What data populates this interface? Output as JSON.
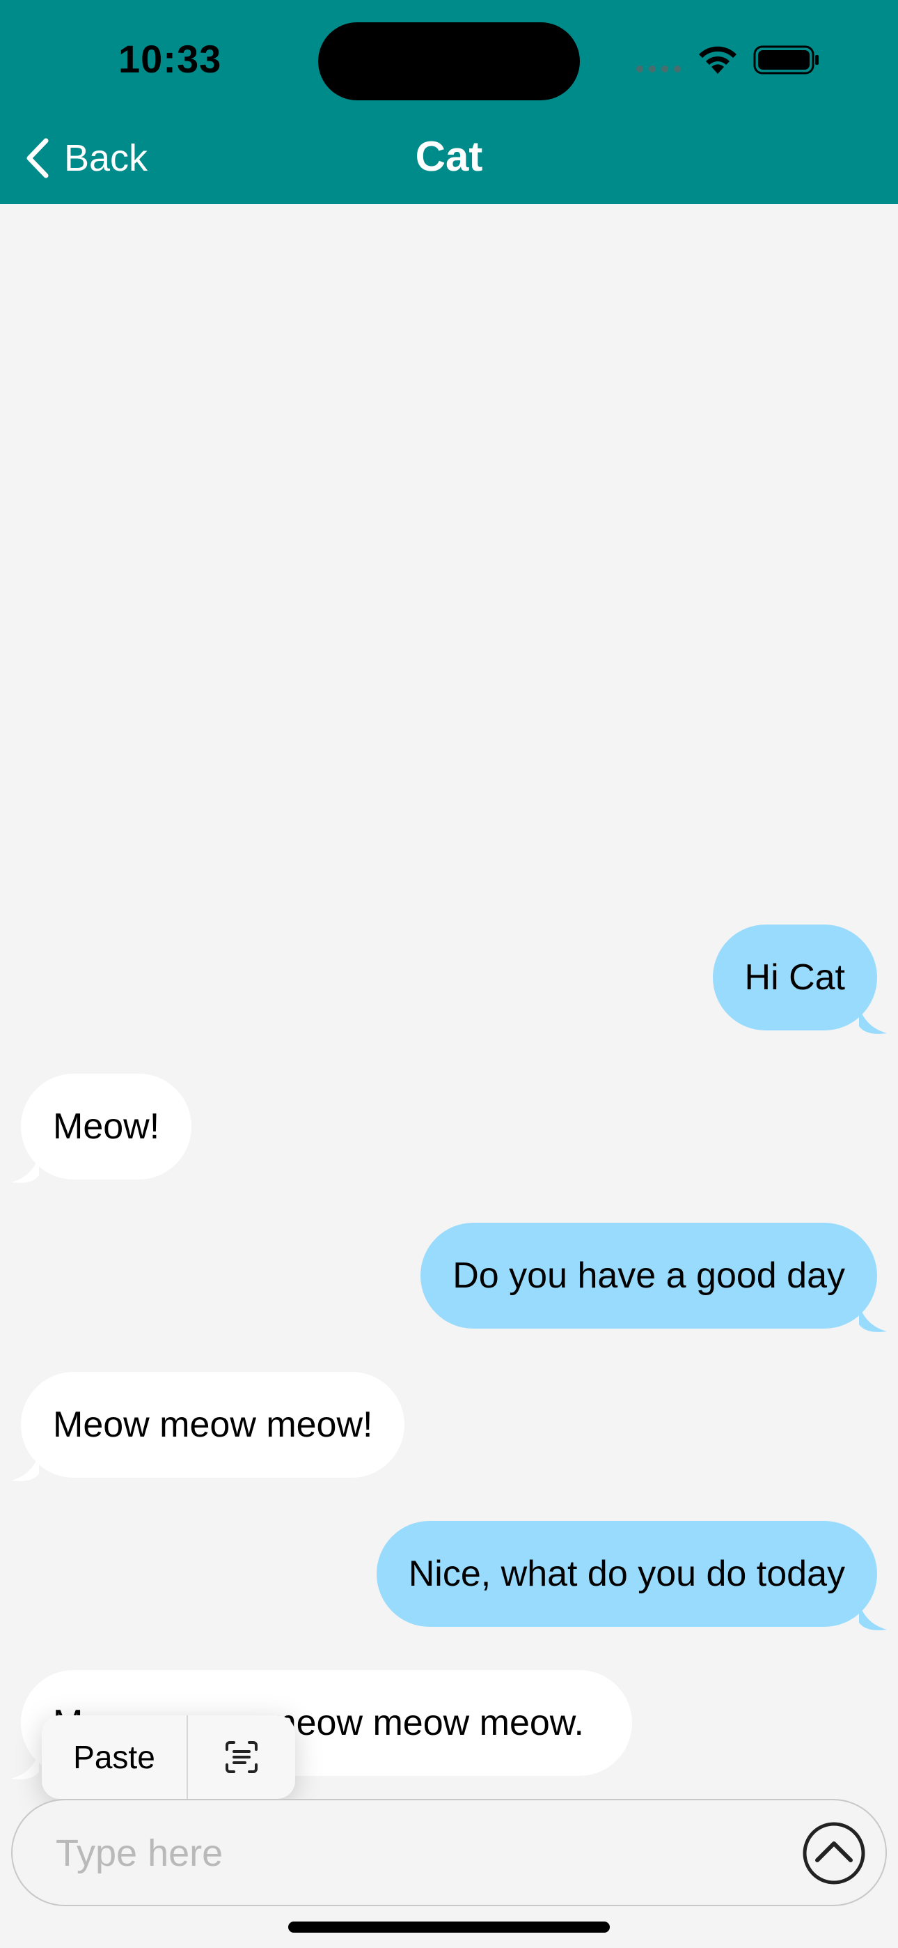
{
  "status_bar": {
    "time": "10:33"
  },
  "nav": {
    "back_label": "Back",
    "title": "Cat"
  },
  "messages": [
    {
      "from": "me",
      "text": "Hi Cat"
    },
    {
      "from": "cat",
      "text": "Meow!"
    },
    {
      "from": "me",
      "text": "Do you have a good day"
    },
    {
      "from": "cat",
      "text": "Meow meow meow!"
    },
    {
      "from": "me",
      "text": "Nice, what do you do today"
    },
    {
      "from": "cat",
      "text": "Meow meow meow meow meow."
    }
  ],
  "context_menu": {
    "paste_label": "Paste",
    "scan_icon": "scan-text-icon"
  },
  "composer": {
    "placeholder": "Type here",
    "value": "",
    "send_icon": "send-arrow-up-icon"
  },
  "colors": {
    "header": "#008b8b",
    "sent_bubble": "#99dbfc",
    "received_bubble": "#ffffff",
    "background": "#f4f4f4"
  }
}
